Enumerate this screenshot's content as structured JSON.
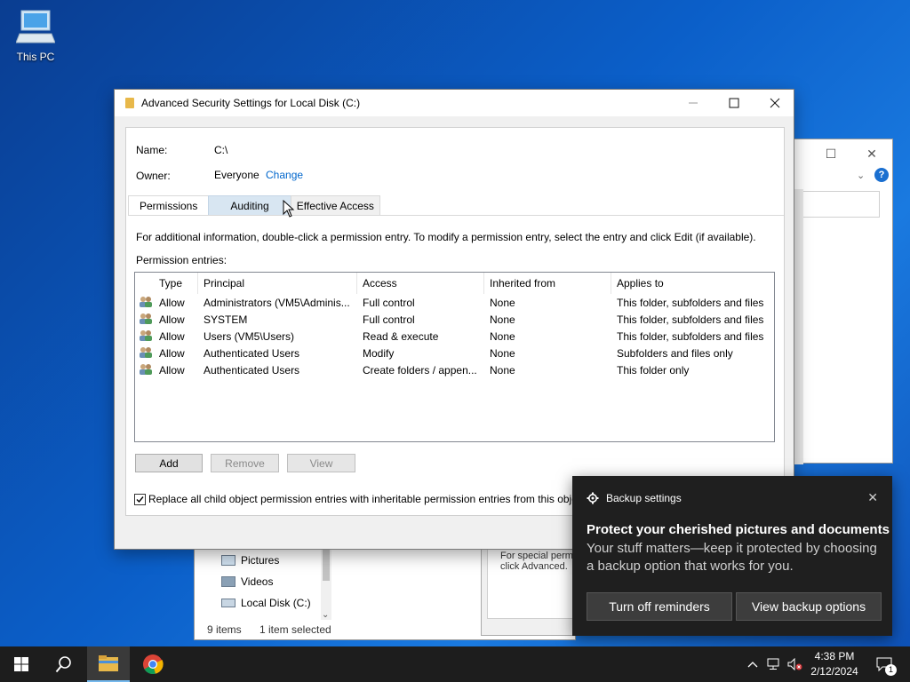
{
  "desktop": {
    "this_pc_label": "This PC"
  },
  "dialog": {
    "title": "Advanced Security Settings for Local Disk (C:)",
    "name_label": "Name:",
    "name_value": "C:\\",
    "owner_label": "Owner:",
    "owner_value": "Everyone",
    "change_link": "Change",
    "tabs": [
      {
        "label": "Permissions"
      },
      {
        "label": "Auditing"
      },
      {
        "label": "Effective Access"
      }
    ],
    "info_text": "For additional information, double-click a permission entry. To modify a permission entry, select the entry and click Edit (if available).",
    "entries_label": "Permission entries:",
    "columns": [
      "Type",
      "Principal",
      "Access",
      "Inherited from",
      "Applies to"
    ],
    "rows": [
      {
        "type": "Allow",
        "principal": "Administrators (VM5\\Adminis...",
        "access": "Full control",
        "inherited": "None",
        "applies": "This folder, subfolders and files"
      },
      {
        "type": "Allow",
        "principal": "SYSTEM",
        "access": "Full control",
        "inherited": "None",
        "applies": "This folder, subfolders and files"
      },
      {
        "type": "Allow",
        "principal": "Users (VM5\\Users)",
        "access": "Read & execute",
        "inherited": "None",
        "applies": "This folder, subfolders and files"
      },
      {
        "type": "Allow",
        "principal": "Authenticated Users",
        "access": "Modify",
        "inherited": "None",
        "applies": "Subfolders and files only"
      },
      {
        "type": "Allow",
        "principal": "Authenticated Users",
        "access": "Create folders / appen...",
        "inherited": "None",
        "applies": "This folder only"
      }
    ],
    "add_button": "Add",
    "remove_button": "Remove",
    "view_button": "View",
    "replace_checkbox_label": "Replace all child object permission entries with inheritable permission entries from this obje"
  },
  "explorer": {
    "nav_items": [
      "Pictures",
      "Videos",
      "Local Disk (C:)"
    ],
    "status_items": "9 items",
    "status_selected": "1 item selected"
  },
  "props_snippet": {
    "line1": "For special permi",
    "line2": "click Advanced."
  },
  "toast": {
    "app_name": "Backup settings",
    "heading": "Protect your cherished pictures and documents",
    "body": "Your stuff matters—keep it protected by choosing a backup option that works for you.",
    "btn_turn_off": "Turn off reminders",
    "btn_view": "View backup options"
  },
  "taskbar": {
    "time": "4:38 PM",
    "date": "2/12/2024",
    "notification_count": "1"
  },
  "colors": {
    "accent": "#0066cc",
    "toast_bg": "#1f1f1f",
    "taskbar_bg": "#1d1d1d"
  }
}
